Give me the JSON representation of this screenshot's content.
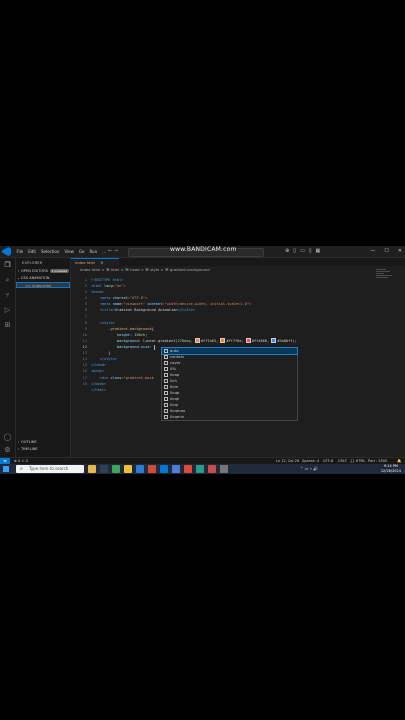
{
  "titlebar": {
    "menu": [
      "File",
      "Edit",
      "Selection",
      "View",
      "Go",
      "Run",
      "…"
    ],
    "watermark": "www.BANDICAM.com"
  },
  "activity_icons": [
    "explorer-icon",
    "search-icon",
    "source-control-icon",
    "run-debug-icon",
    "extensions-icon",
    "account-icon",
    "settings-gear-icon"
  ],
  "sidebar": {
    "title": "EXPLORER",
    "open_editors": "OPEN EDITORS",
    "open_editors_badge": "1 unsaved",
    "folder": "CSS ANIMATION",
    "file": "index.html",
    "outline": "OUTLINE",
    "timeline": "TIMELINE"
  },
  "editor": {
    "tab": "index.html",
    "breadcrumb": "index.html > ⌘ html > ⌘ head > ⌘ style > ⌘ gradient-background"
  },
  "code": {
    "line_numbers": [
      "1",
      "2",
      "3",
      "4",
      "5",
      "6",
      "7",
      "8",
      "9",
      "10",
      "11",
      "12",
      "13",
      "14",
      "15",
      "16",
      "17",
      "18"
    ],
    "current_line": "12",
    "l1": "<!DOCTYPE html>",
    "l2a": "<html ",
    "l2b": "lang",
    "l2c": "=\"en\">",
    "l3": "<head>",
    "l4a": "<meta ",
    "l4b": "charset",
    "l4c": "=\"UTF-8\">",
    "l5a": "<meta ",
    "l5b": "name",
    "l5c": "=\"viewport\" ",
    "l5d": "content",
    "l5e": "=\"width=device-width, initial-scale=1.0\">",
    "l6a": "<title>",
    "l6b": "Gradient Background Animation",
    "l6c": "</title>",
    "l8": "<style>",
    "l9a": ".gradient-background",
    "l9b": "{",
    "l10a": "height",
    "l10b": ": ",
    "l10c": "100vh",
    "l10d": ";",
    "l11a": "background",
    "l11b": ": linear-gradient(",
    "l11c": "270deg",
    "l11d": ", ",
    "l11e": "#ff7a63",
    "l11f": ", ",
    "l11g": "#ff7f0e",
    "l11h": ", ",
    "l11i": "#ff4666",
    "l11j": ", ",
    "l11k": "#3a86ff",
    "l11l": ");",
    "l12a": "background-size",
    "l12b": ": ",
    "l13": "}",
    "l14": "</style>",
    "l15": "</head>",
    "l16": "<body>",
    "l17a": "<div ",
    "l17b": "class",
    "l17c": "=\"gradient-back",
    "l18": "</body>",
    "l19": "</html>"
  },
  "swatch_colors": [
    "#ff7a63",
    "#ff7f0e",
    "#ff4666",
    "#3a86ff"
  ],
  "suggestions": [
    "auto",
    "contain",
    "cover",
    "0%",
    "0cap",
    "0ch",
    "0cm",
    "0cqb",
    "0cqh",
    "0cqi",
    "0cqmax",
    "0cqmin"
  ],
  "statusbar": {
    "position": "Ln 12, Col 26",
    "spaces": "Spaces: 4",
    "encoding": "UTF-8",
    "eol": "CRLF",
    "language": "{} HTML",
    "port": "Port : 5500"
  },
  "taskbar": {
    "search_placeholder": "Type here to search",
    "time": "9:14 PM",
    "date": "12/26/2024"
  }
}
